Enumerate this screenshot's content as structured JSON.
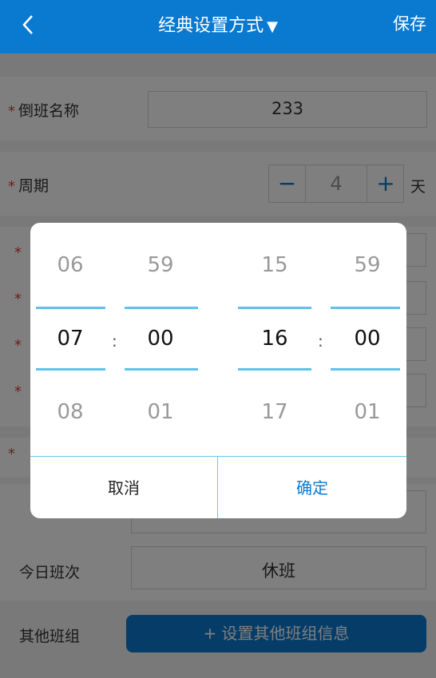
{
  "header": {
    "title": "经典设置方式",
    "title_caret": "▼",
    "save_label": "保存"
  },
  "form": {
    "required_mark": "*",
    "shift_name_label": "倒班名称",
    "shift_name_value": "233",
    "period_label": "周期",
    "period_minus": "−",
    "period_value": "4",
    "period_plus": "+",
    "period_unit": "天",
    "today_shift_label": "今日班次",
    "today_shift_value": "休班",
    "other_group_label": "其他班组",
    "other_group_button": "+ 设置其他班组信息"
  },
  "picker": {
    "columns": [
      {
        "above": "06",
        "selected": "07",
        "below": "08"
      },
      {
        "above": "59",
        "selected": "00",
        "below": "01"
      },
      {
        "above": "15",
        "selected": "16",
        "below": "17"
      },
      {
        "above": "59",
        "selected": "00",
        "below": "01"
      }
    ],
    "separator": ":",
    "cancel_label": "取消",
    "confirm_label": "确定"
  },
  "colors": {
    "accent": "#0a7ad0",
    "picker_line": "#5dc3ea",
    "required": "#e53935"
  }
}
